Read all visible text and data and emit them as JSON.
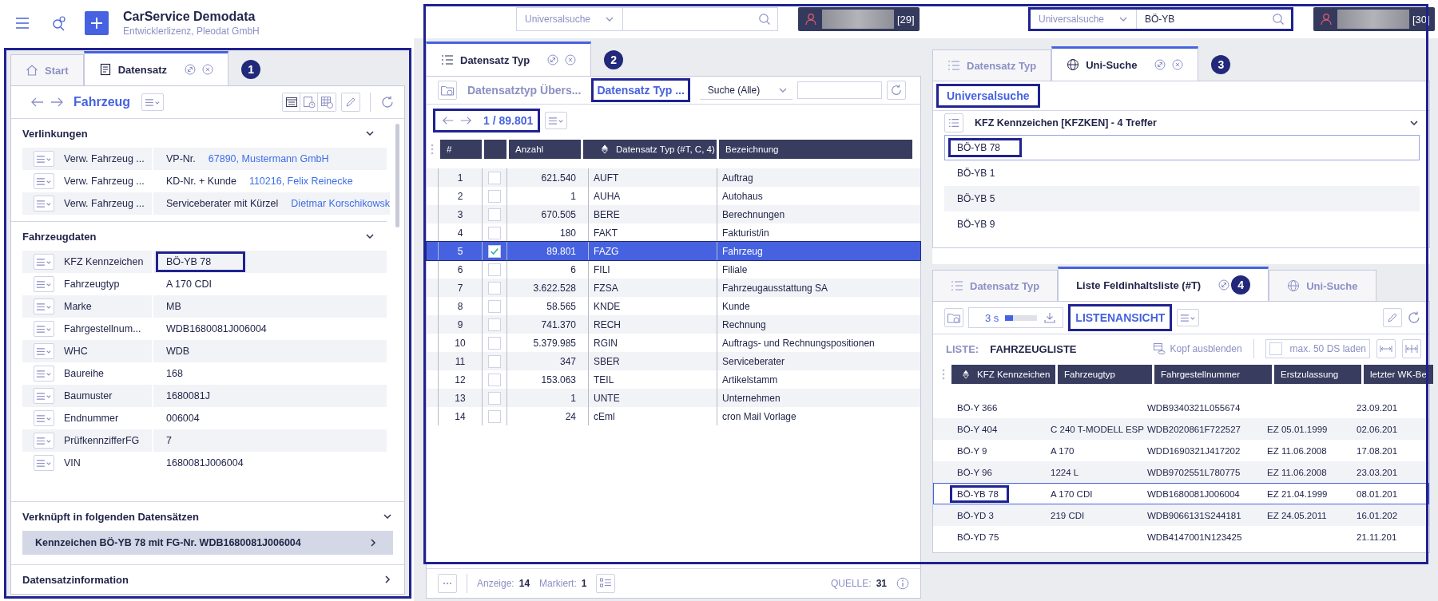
{
  "header": {
    "title": "CarService Demodata",
    "subtitle": "Entwicklerlizenz, Pleodat GmbH"
  },
  "top_bars": [
    {
      "scope": "Universalsuche",
      "user_count": "[29]",
      "highlighted": false
    },
    {
      "scope": "Universalsuche",
      "query": "BÖ-YB",
      "user_count": "[30]",
      "highlighted": true
    }
  ],
  "record_panel": {
    "badge": "1",
    "tabs": [
      {
        "label": "Start",
        "kind": "home",
        "selected": false
      },
      {
        "label": "Datensatz",
        "kind": "record",
        "selected": true
      }
    ],
    "nav_title": "Fahrzeug",
    "sections": [
      {
        "title": "Verlinkungen",
        "expanded": true,
        "rows": [
          {
            "label": "Verw. Fahrzeug ...",
            "value": "VP-Nr.",
            "link": "67890, Mustermann GmbH",
            "highlighted": false
          },
          {
            "label": "Verw. Fahrzeug ...",
            "value": "KD-Nr. + Kunde",
            "link": "110216, Felix Reinecke",
            "highlighted": false
          },
          {
            "label": "Verw. Fahrzeug ...",
            "value": "Serviceberater mit Kürzel",
            "link": "Dietmar Korschikowsk",
            "highlighted": false
          }
        ]
      },
      {
        "title": "Fahrzeugdaten",
        "expanded": true,
        "rows": [
          {
            "label": "KFZ Kennzeichen",
            "value": "BÖ-YB 78",
            "highlighted": true
          },
          {
            "label": "Fahrzeugtyp",
            "value": "A 170 CDI",
            "highlighted": false
          },
          {
            "label": "Marke",
            "value": "MB",
            "highlighted": false
          },
          {
            "label": "Fahrgestellnum...",
            "value": "WDB1680081J006004",
            "highlighted": false
          },
          {
            "label": "WHC",
            "value": "WDB",
            "highlighted": false
          },
          {
            "label": "Baureihe",
            "value": "168",
            "highlighted": false
          },
          {
            "label": "Baumuster",
            "value": "1680081J",
            "highlighted": false
          },
          {
            "label": "Endnummer",
            "value": "006004",
            "highlighted": false
          },
          {
            "label": "PrüfkennzifferFG",
            "value": "7",
            "highlighted": false
          },
          {
            "label": "VIN",
            "value": "1680081J006004",
            "highlighted": false
          }
        ]
      }
    ],
    "linked": {
      "title": "Verknüpft in folgenden Datensätzen",
      "expanded": true,
      "items": [
        {
          "label": "Kennzeichen BÖ-YB 78 mit FG-Nr. WDB1680081J006004"
        }
      ]
    },
    "info": {
      "title": "Datensatzinformation",
      "expanded": false
    }
  },
  "type_panel": {
    "badge": "2",
    "tabs": [
      {
        "label": "Datensatz Typ",
        "kind": "list",
        "selected": true
      }
    ],
    "views": [
      {
        "label": "Datensatztyp Übers...",
        "selected": false,
        "highlighted": false
      },
      {
        "label": "Datensatz Typ ...",
        "selected": true,
        "highlighted": true
      }
    ],
    "search_scope": "Suche (Alle)",
    "pager": {
      "text": "1 / 89.801",
      "highlighted": true
    },
    "columns": [
      "#",
      "Anzahl",
      "Datensatz Typ (#T, C, 4)",
      "Bezeichnung"
    ],
    "rows": [
      {
        "num": "1",
        "checked": false,
        "count": "621.540",
        "code": "AUFT",
        "name": "Auftrag",
        "selected": false
      },
      {
        "num": "2",
        "checked": false,
        "count": "1",
        "code": "AUHA",
        "name": "Autohaus",
        "selected": false
      },
      {
        "num": "3",
        "checked": false,
        "count": "670.505",
        "code": "BERE",
        "name": "Berechnungen",
        "selected": false
      },
      {
        "num": "4",
        "checked": false,
        "count": "180",
        "code": "FAKT",
        "name": "Fakturist/in",
        "selected": false
      },
      {
        "num": "5",
        "checked": true,
        "count": "89.801",
        "code": "FAZG",
        "name": "Fahrzeug",
        "selected": true
      },
      {
        "num": "6",
        "checked": false,
        "count": "6",
        "code": "FILI",
        "name": "Filiale",
        "selected": false
      },
      {
        "num": "7",
        "checked": false,
        "count": "3.622.528",
        "code": "FZSA",
        "name": "Fahrzeugausstattung SA",
        "selected": false
      },
      {
        "num": "8",
        "checked": false,
        "count": "58.565",
        "code": "KNDE",
        "name": "Kunde",
        "selected": false
      },
      {
        "num": "9",
        "checked": false,
        "count": "741.370",
        "code": "RECH",
        "name": "Rechnung",
        "selected": false
      },
      {
        "num": "10",
        "checked": false,
        "count": "5.379.985",
        "code": "RGIN",
        "name": "Auftrags- und Rechnungspositionen",
        "selected": false
      },
      {
        "num": "11",
        "checked": false,
        "count": "347",
        "code": "SBER",
        "name": "Serviceberater",
        "selected": false
      },
      {
        "num": "12",
        "checked": false,
        "count": "153.063",
        "code": "TEIL",
        "name": "Artikelstamm",
        "selected": false
      },
      {
        "num": "13",
        "checked": false,
        "count": "1",
        "code": "UNTE",
        "name": "Unternehmen",
        "selected": false
      },
      {
        "num": "14",
        "checked": false,
        "count": "24",
        "code": "cEml",
        "name": "cron Mail Vorlage",
        "selected": false
      }
    ],
    "footer": {
      "shown_label": "Anzeige:",
      "shown": "14",
      "marked_label": "Markiert:",
      "marked": "1",
      "source_label": "QUELLE:",
      "source": "31"
    }
  },
  "search_panel": {
    "badge": "3",
    "tabs": [
      {
        "label": "Datensatz Typ",
        "kind": "list",
        "selected": false
      },
      {
        "label": "Uni-Suche",
        "kind": "globe",
        "selected": true
      }
    ],
    "heading": {
      "text": "Universalsuche",
      "highlighted": true
    },
    "group": {
      "title": "KFZ Kennzeichen [KFZKEN] - 4 Treffer",
      "expanded": true
    },
    "results": [
      {
        "label": "BÖ-YB 78",
        "selected": true,
        "highlighted": true
      },
      {
        "label": "BÖ-YB 1",
        "selected": false,
        "highlighted": false
      },
      {
        "label": "BÖ-YB 5",
        "selected": false,
        "highlighted": false
      },
      {
        "label": "BÖ-YB 9",
        "selected": false,
        "highlighted": false
      }
    ]
  },
  "list_panel": {
    "badge": "4",
    "tabs": [
      {
        "label": "Datensatz Typ",
        "kind": "list",
        "selected": false
      },
      {
        "label": "Liste Feldinhaltsliste (#T)",
        "kind": "plain",
        "selected": true
      },
      {
        "label": "Uni-Suche",
        "kind": "globe",
        "selected": false
      }
    ],
    "timer": {
      "label": "3 s",
      "level": 0.25
    },
    "view_title": {
      "text": "LISTENANSICHT",
      "highlighted": true
    },
    "list_label": "LISTE:",
    "list_name": "FAHRZEUGLISTE",
    "hide_header": "Kopf ausblenden",
    "max_load": {
      "label": "max. 50 DS laden",
      "checked": false
    },
    "columns": [
      "KFZ Kennzeichen",
      "Fahrzeugtyp",
      "Fahrgestellnummer",
      "Erstzulassung",
      "letzter WK-Be"
    ],
    "rows": [
      {
        "plate": "BÖ-Y 366",
        "vin": "WDB9340321L055674",
        "last": "23.09.201",
        "selected": false,
        "highlighted": false
      },
      {
        "plate": "BÖ-Y 404",
        "type": "C 240 T-MODELL ESP",
        "vin": "WDB2020861F722527",
        "reg": "EZ 05.01.1999",
        "last": "02.06.201",
        "selected": false,
        "highlighted": false
      },
      {
        "plate": "BÖ-Y 9",
        "type": "A 170",
        "vin": "WDD1690321J417202",
        "reg": "EZ 11.06.2008",
        "last": "17.08.201",
        "selected": false,
        "highlighted": false
      },
      {
        "plate": "BÖ-Y 96",
        "type": "1224 L",
        "vin": "WDB9702551L780775",
        "reg": "EZ 11.06.2008",
        "last": "23.03.201",
        "selected": false,
        "highlighted": false
      },
      {
        "plate": "BÖ-YB 78",
        "type": "A 170 CDI",
        "vin": "WDB1680081J006004",
        "reg": "EZ 21.04.1999",
        "last": "08.01.201",
        "selected": true,
        "highlighted": true
      },
      {
        "plate": "BÖ-YD 3",
        "type": "219 CDI",
        "vin": "WDB9066131S244181",
        "reg": "EZ 24.05.2011",
        "last": "16.01.202",
        "selected": false,
        "highlighted": false
      },
      {
        "plate": "BÖ-YD 75",
        "vin": "WDB4147001N123425",
        "last": "21.11.201",
        "selected": false,
        "highlighted": false
      }
    ]
  }
}
